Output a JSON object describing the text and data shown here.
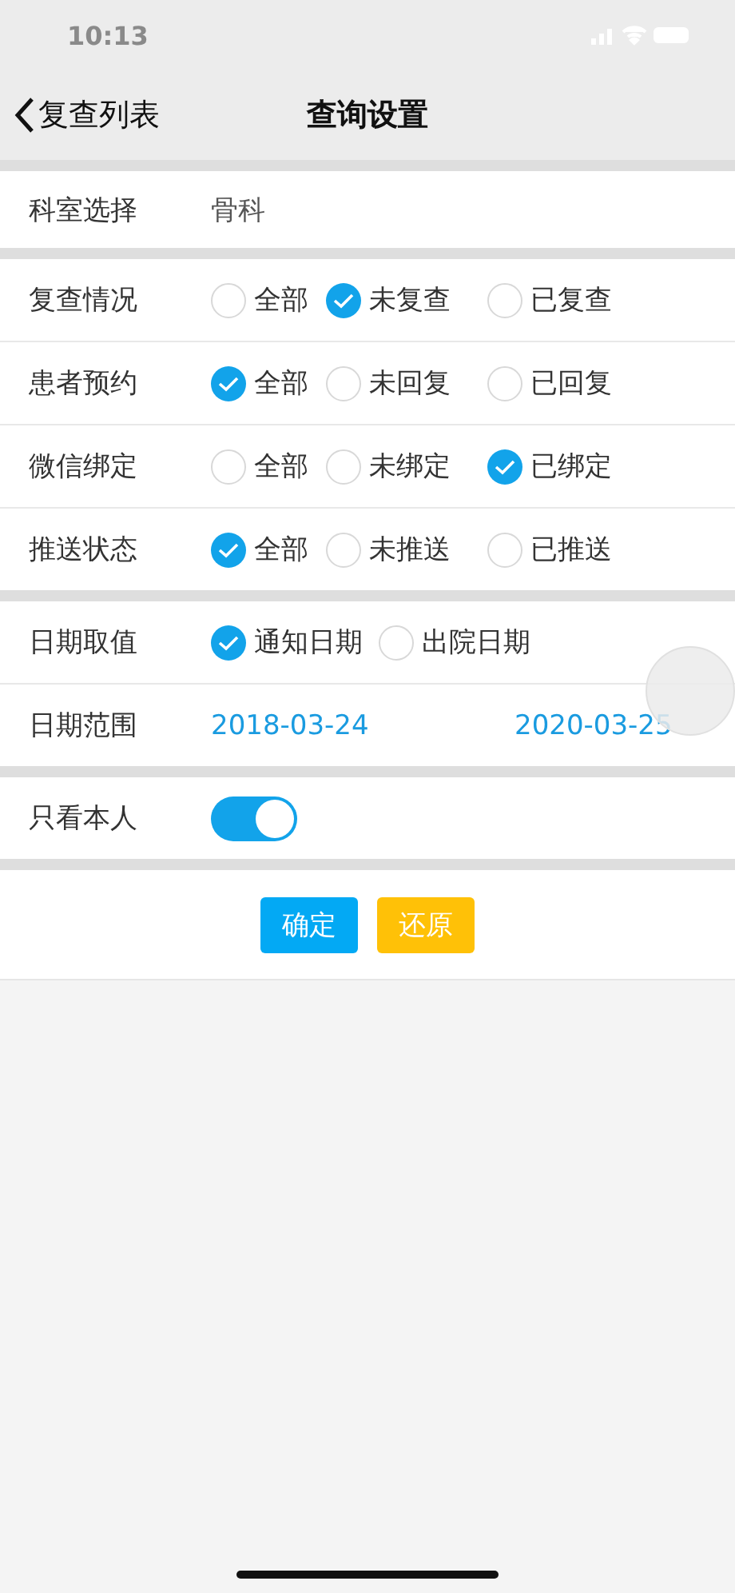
{
  "status_bar": {
    "time": "10:13"
  },
  "nav": {
    "back": "复查列表",
    "title": "查询设置"
  },
  "sections": [
    {
      "rows": [
        {
          "kind": "value",
          "label": "科室选择",
          "value": "骨科"
        }
      ]
    },
    {
      "rows": [
        {
          "kind": "radio",
          "label": "复查情况",
          "options": [
            {
              "label": "全部",
              "selected": false
            },
            {
              "label": "未复查",
              "selected": true
            },
            {
              "label": "已复查",
              "selected": false
            }
          ]
        },
        {
          "kind": "radio",
          "label": "患者预约",
          "options": [
            {
              "label": "全部",
              "selected": true
            },
            {
              "label": "未回复",
              "selected": false
            },
            {
              "label": "已回复",
              "selected": false
            }
          ]
        },
        {
          "kind": "radio",
          "label": "微信绑定",
          "options": [
            {
              "label": "全部",
              "selected": false
            },
            {
              "label": "未绑定",
              "selected": false
            },
            {
              "label": "已绑定",
              "selected": true
            }
          ]
        },
        {
          "kind": "radio",
          "label": "推送状态",
          "options": [
            {
              "label": "全部",
              "selected": true
            },
            {
              "label": "未推送",
              "selected": false
            },
            {
              "label": "已推送",
              "selected": false
            }
          ]
        }
      ]
    },
    {
      "rows": [
        {
          "kind": "radio",
          "label": "日期取值",
          "options": [
            {
              "label": "通知日期",
              "selected": true
            },
            {
              "label": "出院日期",
              "selected": false
            }
          ]
        },
        {
          "kind": "dates",
          "label": "日期范围",
          "start": "2018-03-24",
          "end": "2020-03-25"
        }
      ]
    },
    {
      "rows": [
        {
          "kind": "switch",
          "label": "只看本人",
          "on": true
        }
      ]
    }
  ],
  "buttons": [
    {
      "kind": "confirm",
      "label": "确定"
    },
    {
      "kind": "reset",
      "label": "还原"
    }
  ]
}
